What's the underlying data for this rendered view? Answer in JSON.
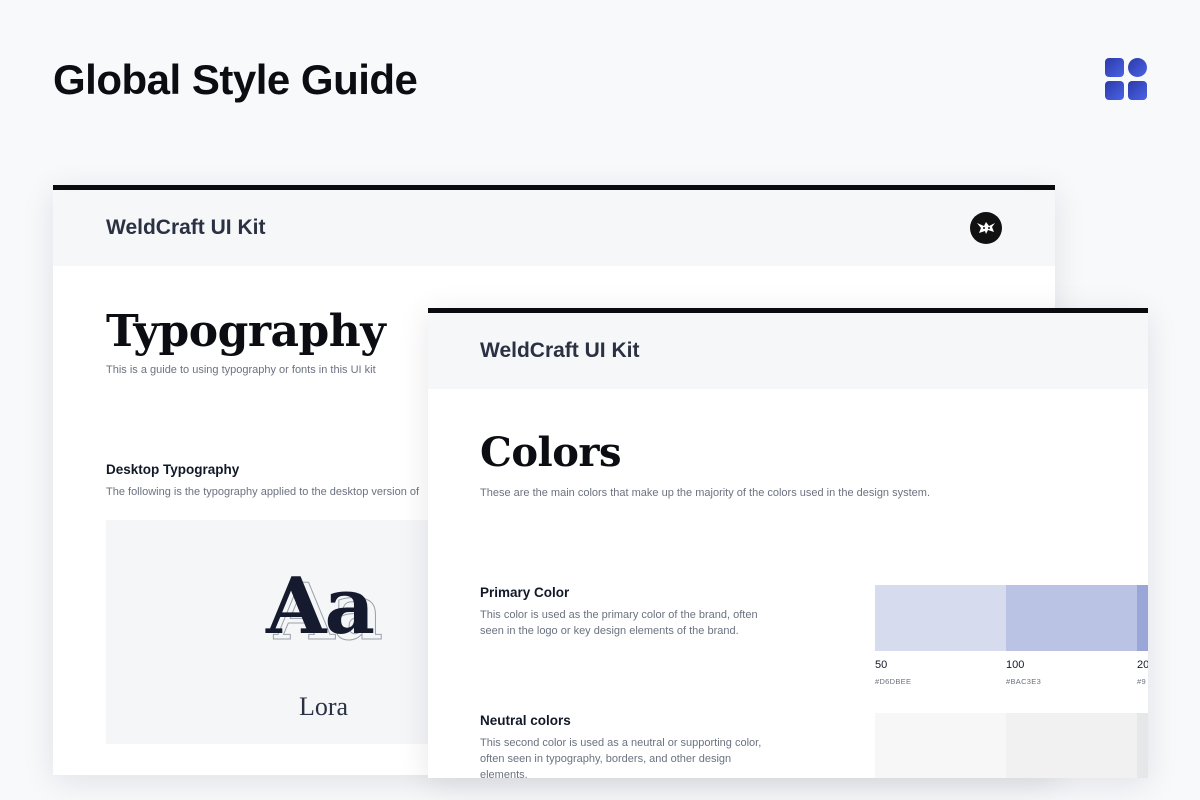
{
  "page": {
    "title": "Global Style Guide",
    "logo_icon": "four-squares-logo-icon",
    "accent_color": "#3b4fd1"
  },
  "typography_card": {
    "kit_name": "WeldCraft UI Kit",
    "avatar_icon": "cat-avatar-icon",
    "title": "Typography",
    "description": "This is a guide to using typography or fonts in this UI kit",
    "section": {
      "title": "Desktop Typography",
      "description": "The following is the typography applied to the desktop version of"
    },
    "specimen": {
      "glyphs": "Aa",
      "font_name": "Lora"
    }
  },
  "colors_card": {
    "kit_name": "WeldCraft UI Kit",
    "title": "Colors",
    "description": "These are the main colors that make up the majority of the colors used in the design system.",
    "primary": {
      "title": "Primary Color",
      "description": "This color is used as the primary color of the brand, often seen in the logo or key design elements of the brand.",
      "swatches": [
        {
          "level": "50",
          "hex": "#D6DBEE",
          "color": "#d6dbee"
        },
        {
          "level": "100",
          "hex": "#BAC3E3",
          "color": "#bac3e3"
        },
        {
          "level": "20",
          "hex": "#9",
          "color": "#9aa6d8"
        }
      ]
    },
    "neutral": {
      "title": "Neutral colors",
      "description": "This second color is used as a neutral or supporting color, often seen in typography, borders, and other design elements.",
      "swatches": [
        {
          "color": "#f7f7f8"
        },
        {
          "color": "#f1f1f2"
        },
        {
          "color": "#e6e7e9"
        }
      ]
    }
  }
}
